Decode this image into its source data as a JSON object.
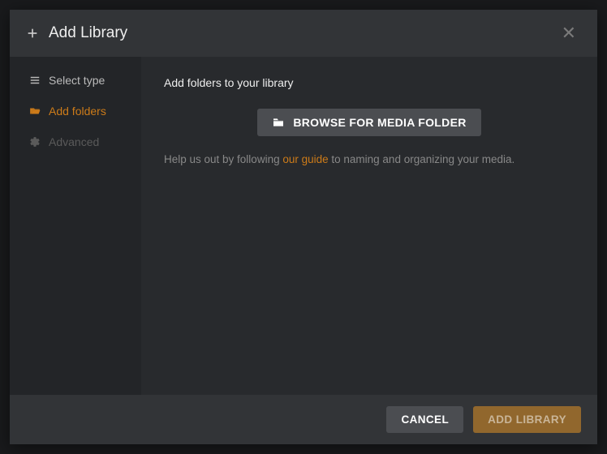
{
  "header": {
    "title": "Add Library"
  },
  "sidebar": {
    "items": [
      {
        "label": "Select type"
      },
      {
        "label": "Add folders"
      },
      {
        "label": "Advanced"
      }
    ]
  },
  "main": {
    "instruction": "Add folders to your library",
    "browse_label": "BROWSE FOR MEDIA FOLDER",
    "help_prefix": "Help us out by following ",
    "help_link": "our guide",
    "help_suffix": " to naming and organizing your media."
  },
  "footer": {
    "cancel_label": "CANCEL",
    "submit_label": "ADD LIBRARY"
  }
}
